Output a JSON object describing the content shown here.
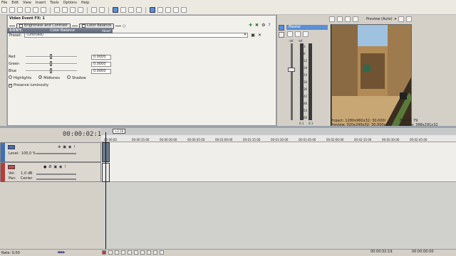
{
  "menu": [
    "File",
    "Edit",
    "View",
    "Insert",
    "Tools",
    "Options",
    "Help"
  ],
  "fx": {
    "title": "Video Event FX: 1",
    "chain": [
      "Brightness and Contrast",
      "Color Balance"
    ],
    "preset_label": "Preset:",
    "preset_value": "(Untitled)",
    "plugin_brand": "SONY.",
    "plugin_name": "Color Balance",
    "plugin_badge": "About",
    "sliders": [
      {
        "label": "Red",
        "value": "0.0000",
        "level": 0.5
      },
      {
        "label": "Green",
        "value": "0.0000",
        "level": 0.5
      },
      {
        "label": "Blue",
        "value": "0.0000",
        "level": 0.5
      }
    ],
    "radios": [
      {
        "label": "Highlights",
        "selected": false
      },
      {
        "label": "Midtones",
        "selected": true
      },
      {
        "label": "Shadow",
        "selected": false
      }
    ],
    "preserve_label": "Preserve luminosity"
  },
  "mixer": {
    "master_label": "Master",
    "db_top_left": "-Inf.",
    "db_top_right": "-Inf.",
    "scale": [
      "3",
      "6",
      "12",
      "18",
      "24",
      "30",
      "36",
      "42",
      "48",
      "54",
      "60"
    ],
    "bottom_left": "0.1",
    "bottom_right": "0.1"
  },
  "preview": {
    "mode_label": "Preview (Auto)",
    "project_label": "Project:",
    "project_value": "1280x960x32; 30,000i",
    "preview_label": "Preview:",
    "preview_value": "320x240x32; 30,000p",
    "frame_label": "Frame:",
    "frame_value": "79",
    "display_label": "Display:",
    "display_value": "388x291x32"
  },
  "timeline": {
    "timecode": "00:00:02:19",
    "marker": "+2:16",
    "ruler_labels": [
      "00:00:00",
      "00:00:15:00",
      "00:00:30:00",
      "00:00:45:00",
      "00:01:00:00",
      "00:01:15:00",
      "00:01:30:00",
      "00:01:45:00",
      "00:02:00:00",
      "00:02:15:00",
      "00:02:30:00",
      "00:02:45:00"
    ],
    "video_track": {
      "level_label": "Level:",
      "level_value": "100,0 %"
    },
    "audio_track": {
      "vol_label": "Vol:",
      "vol_value": "1,0 dB",
      "pan_label": "Pan:",
      "pan_value": "Center"
    }
  },
  "status": {
    "rate": "Rate: 0,00",
    "end_time": "00:00:02:19",
    "record_time": "00:00:00:00"
  }
}
